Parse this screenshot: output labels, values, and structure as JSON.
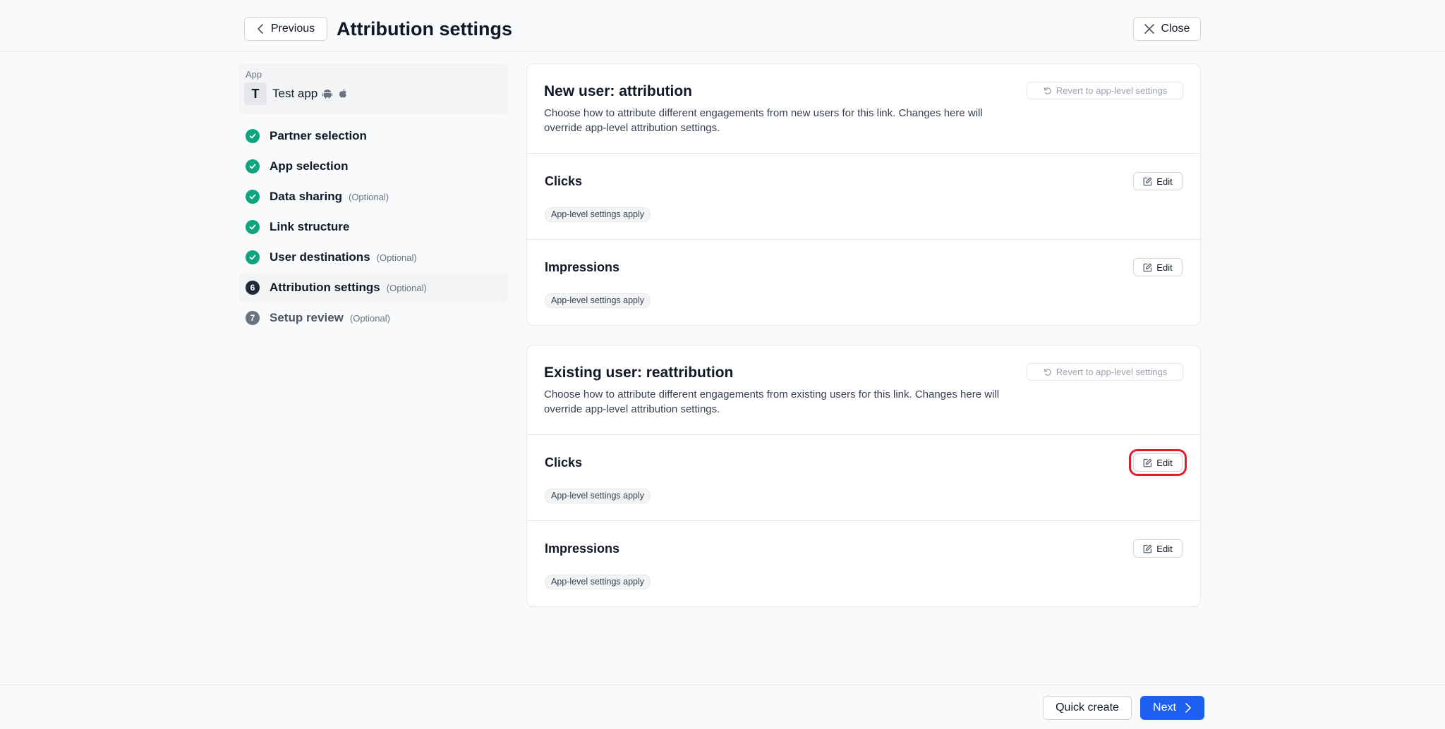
{
  "header": {
    "previous_label": "Previous",
    "title": "Attribution settings",
    "close_label": "Close"
  },
  "sidebar": {
    "app_label": "App",
    "app_avatar": "T",
    "app_name": "Test app",
    "app_platform_icons": [
      "android-icon",
      "apple-icon"
    ],
    "steps": [
      {
        "label": "Partner selection",
        "optional": "",
        "status": "done",
        "marker": ""
      },
      {
        "label": "App selection",
        "optional": "",
        "status": "done",
        "marker": ""
      },
      {
        "label": "Data sharing",
        "optional": "(Optional)",
        "status": "done",
        "marker": ""
      },
      {
        "label": "Link structure",
        "optional": "",
        "status": "done",
        "marker": ""
      },
      {
        "label": "User destinations",
        "optional": "(Optional)",
        "status": "done",
        "marker": ""
      },
      {
        "label": "Attribution settings",
        "optional": "(Optional)",
        "status": "current",
        "marker": "6"
      },
      {
        "label": "Setup review",
        "optional": "(Optional)",
        "status": "todo",
        "marker": "7"
      }
    ]
  },
  "sections": [
    {
      "title": "New user: attribution",
      "description": "Choose how to attribute different engagements from new users for this link. Changes here will override app-level attribution settings.",
      "revert_label": "Revert to app-level settings",
      "rows": [
        {
          "title": "Clicks",
          "edit_label": "Edit",
          "badge": "App-level settings apply"
        },
        {
          "title": "Impressions",
          "edit_label": "Edit",
          "badge": "App-level settings apply"
        }
      ]
    },
    {
      "title": "Existing user: reattribution",
      "description": "Choose how to attribute different engagements from existing users for this link. Changes here will override app-level attribution settings.",
      "revert_label": "Revert to app-level settings",
      "rows": [
        {
          "title": "Clicks",
          "edit_label": "Edit",
          "badge": "App-level settings apply"
        },
        {
          "title": "Impressions",
          "edit_label": "Edit",
          "badge": "App-level settings apply"
        }
      ]
    }
  ],
  "footer": {
    "quick_create_label": "Quick create",
    "next_label": "Next"
  },
  "colors": {
    "accent": "#1d5ff0",
    "success": "#10a37f",
    "highlight": "#e11d2a"
  }
}
